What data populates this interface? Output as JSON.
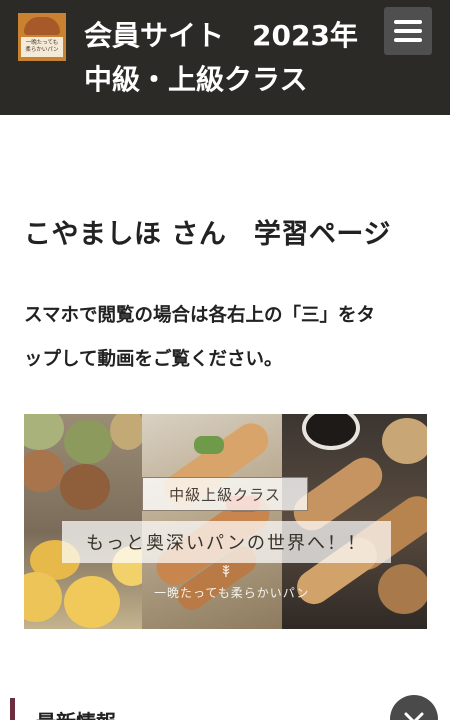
{
  "header": {
    "logo": {
      "lines": [
        "一晩たっても",
        "柔らかいパン"
      ]
    },
    "title_line1": "会員サイト　2023年",
    "title_line2": "中級・上級クラス",
    "menu_icon": "hamburger-menu-icon",
    "background_color": "#2b2a26"
  },
  "main": {
    "heading": "こやましほ さん　学習ページ",
    "instruction_line1": "スマホで閲覧の場合は各右上の「三」をタ",
    "instruction_line2": "ップして動画をご覧ください。"
  },
  "banner": {
    "tag": "中級上級クラス",
    "slogan": "もっと奥深いパンの世界へ！！",
    "brand_small": "一晩たっても柔らかいパン"
  },
  "news": {
    "title": "最新情報",
    "accent_color": "#6b2e3e",
    "toggle_icon": "chevron-down-icon"
  }
}
